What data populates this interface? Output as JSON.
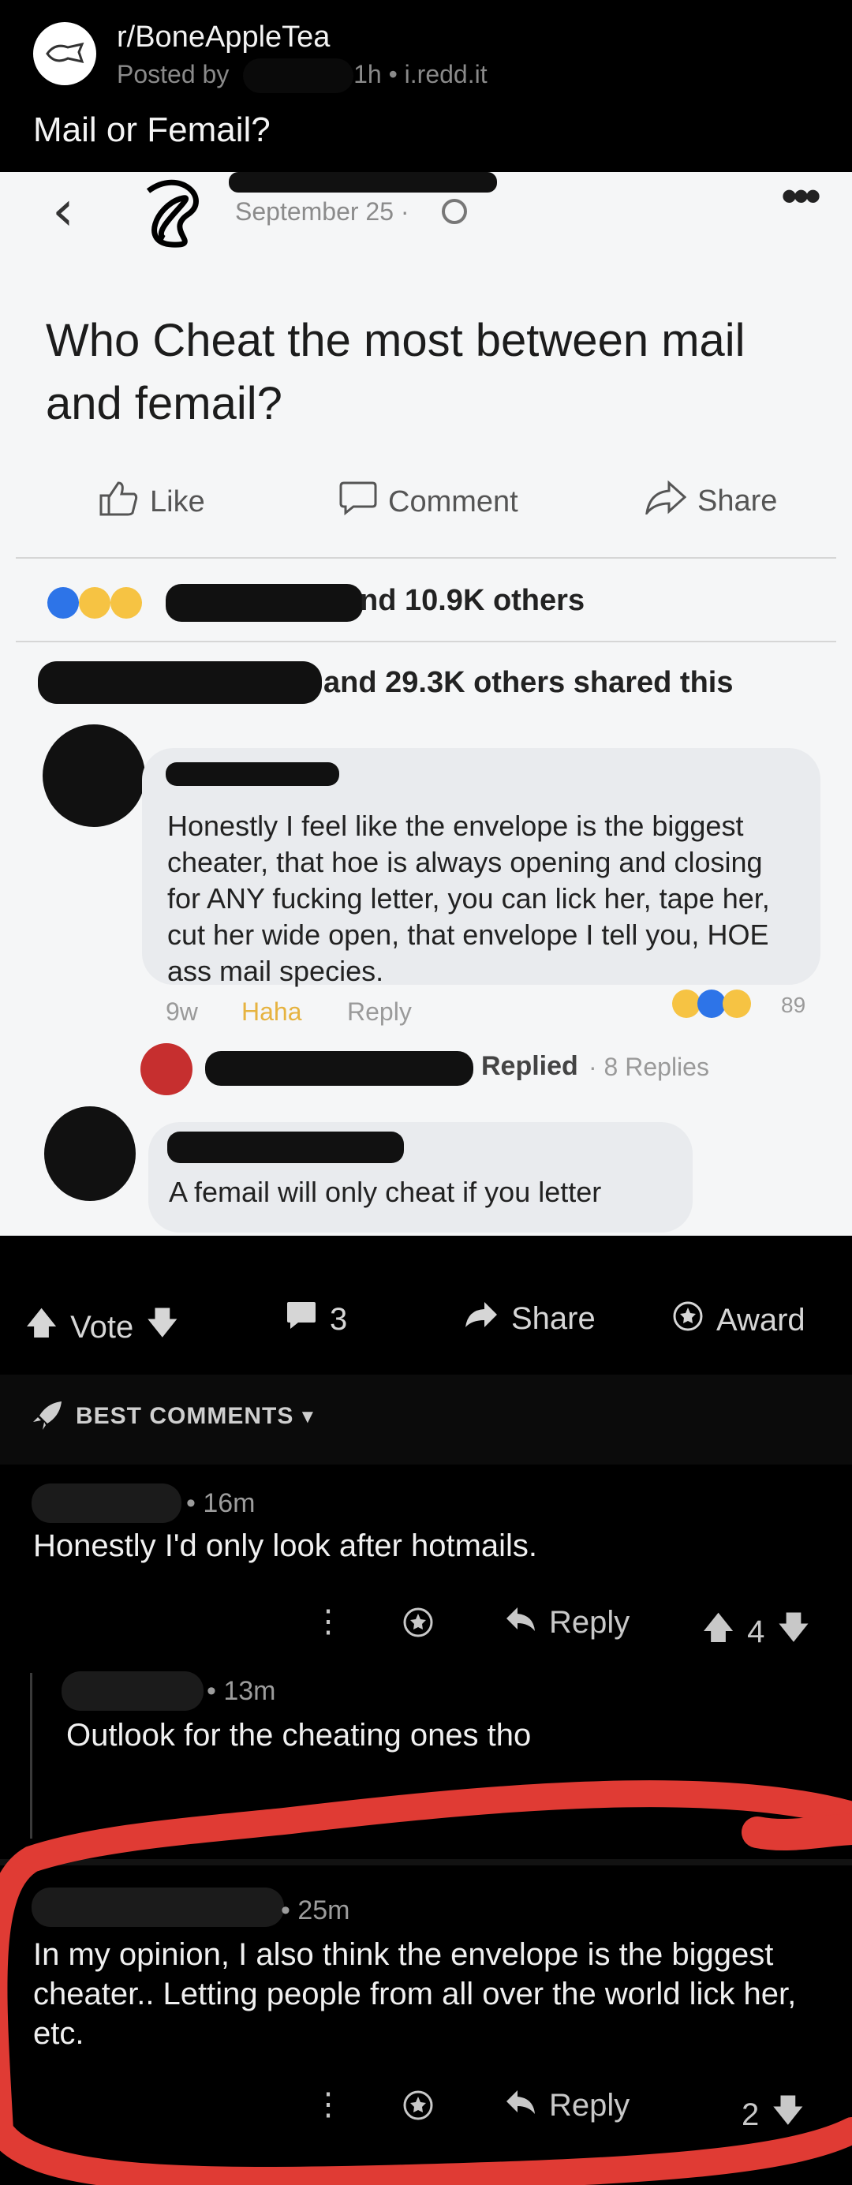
{
  "header": {
    "subreddit": "r/BoneAppleTea",
    "posted_by": "Posted by",
    "age_source": "1h • i.redd.it",
    "title": "Mail or Femail?"
  },
  "fb_post": {
    "date": "September 25 ·",
    "question": "Who Cheat the most between mail and femail?",
    "actions": {
      "like": "Like",
      "comment": "Comment",
      "share": "Share"
    },
    "reactions_text": "nd 10.9K others",
    "shared_text": "and 29.3K others shared this",
    "comments": [
      {
        "text": "Honestly I feel like the envelope is the biggest cheater, that hoe is always opening and closing for ANY fucking letter, you can lick her, tape her, cut her wide open, that envelope I tell you, HOE ass mail species.",
        "age": "9w",
        "haha": "Haha",
        "reply": "Reply",
        "reaction_count": "89"
      },
      {
        "replied": "Replied",
        "replies": "· 8 Replies"
      },
      {
        "text": "A femail will only cheat if you letter"
      }
    ]
  },
  "action_bar": {
    "vote": "Vote",
    "comments_count": "3",
    "share": "Share",
    "award": "Award"
  },
  "sort_label": "BEST COMMENTS",
  "comments": [
    {
      "age": "• 16m",
      "body": "Honestly I'd only look after hotmails.",
      "reply": "Reply",
      "score": "4"
    },
    {
      "age": "• 13m",
      "body": "Outlook for the cheating ones tho"
    },
    {
      "age": "• 25m",
      "body": "In my opinion, I also think the envelope is the biggest cheater.. Letting people from all over the world lick her, etc.",
      "reply": "Reply",
      "score": "2"
    }
  ],
  "colors": {
    "annotation_red": "#e03b34",
    "fb_blue": "#2d74e8",
    "background": "#000000"
  }
}
